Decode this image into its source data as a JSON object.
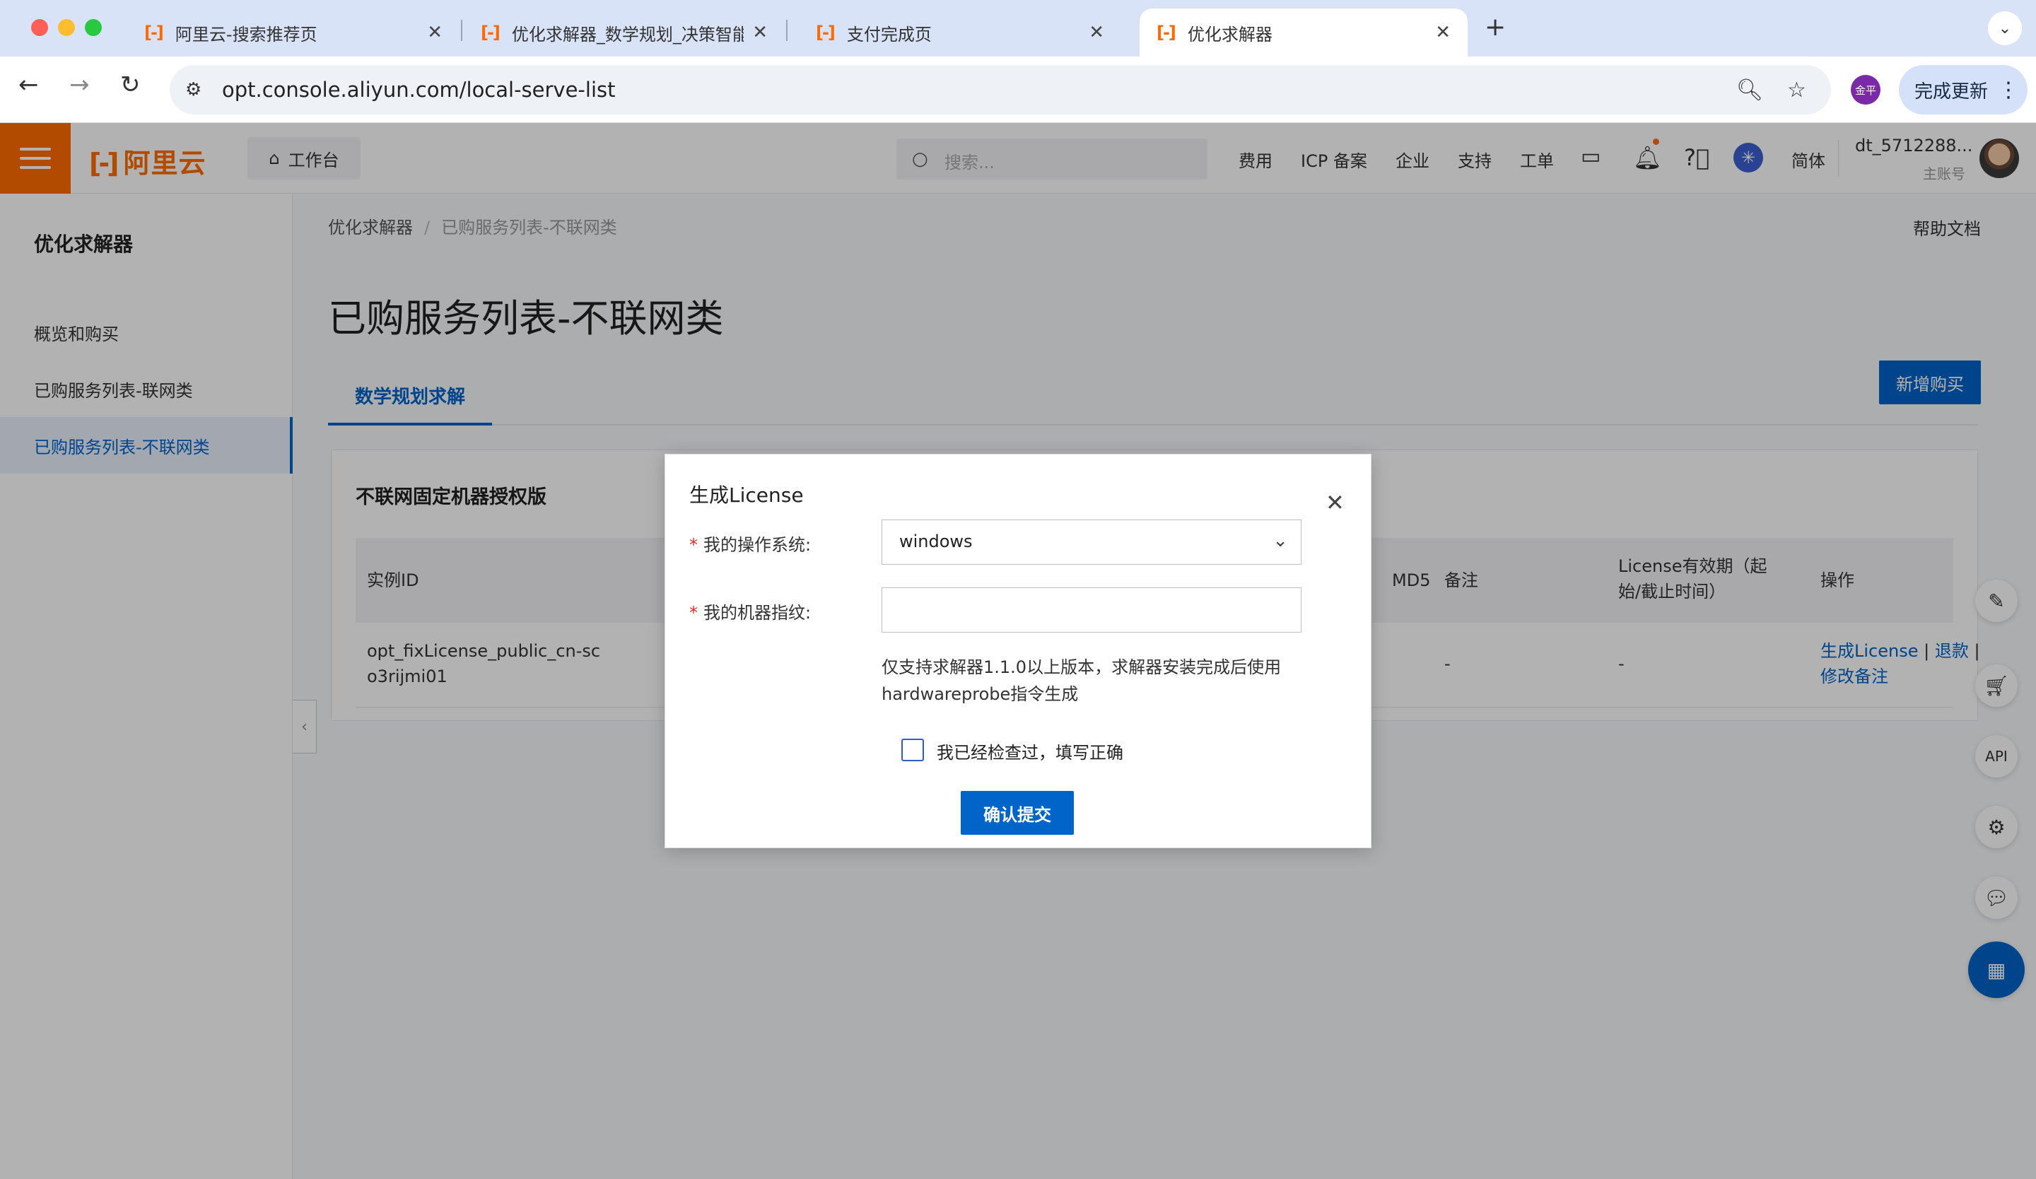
{
  "browser": {
    "tabs": [
      {
        "title": "阿里云-搜索推荐页",
        "active": false
      },
      {
        "title": "优化求解器_数学规划_决策智能",
        "active": false
      },
      {
        "title": "支付完成页",
        "active": false
      },
      {
        "title": "优化求解器",
        "active": true
      }
    ],
    "url": "opt.console.aliyun.com/local-serve-list",
    "profile_initials": "金平",
    "update_label": "完成更新"
  },
  "header": {
    "brand": "阿里云",
    "workbench": "工作台",
    "search_placeholder": "搜索...",
    "nav": [
      "费用",
      "ICP 备案",
      "企业",
      "支持",
      "工单"
    ],
    "language": "简体",
    "user_name": "dt_5712288...",
    "user_role": "主账号"
  },
  "sidebar": {
    "title": "优化求解器",
    "items": [
      {
        "label": "概览和购买",
        "active": false
      },
      {
        "label": "已购服务列表-联网类",
        "active": false
      },
      {
        "label": "已购服务列表-不联网类",
        "active": true
      }
    ]
  },
  "main": {
    "breadcrumb": [
      "优化求解器",
      "已购服务列表-不联网类"
    ],
    "help_doc": "帮助文档",
    "page_title": "已购服务列表-不联网类",
    "tab": "数学规划求解",
    "new_purchase": "新增购买",
    "card_title": "不联网固定机器授权版",
    "table": {
      "headers": {
        "instance_id": "实例ID",
        "md5": "MD5",
        "remark": "备注",
        "validity": "License有效期（起始/截止时间）",
        "action": "操作"
      },
      "row": {
        "instance_id": "opt_fixLicense_public_cn-sco3rijmi01",
        "remark": "-",
        "validity": "-",
        "action_generate": "生成License",
        "action_refund": "退款",
        "action_edit": "修改备注",
        "action_sep": "|"
      }
    }
  },
  "modal": {
    "title": "生成License",
    "os_label": "我的操作系统:",
    "os_value": "windows",
    "fingerprint_label": "我的机器指纹:",
    "fingerprint_value": "",
    "required_mark": "*",
    "hint": "仅支持求解器1.1.0以上版本，求解器安装完成后使用hardwareprobe指令生成",
    "check_label": "我已经检查过，填写正确",
    "submit": "确认提交"
  },
  "colors": {
    "brand_orange": "#ff6a00",
    "primary_blue": "#0064c8"
  }
}
